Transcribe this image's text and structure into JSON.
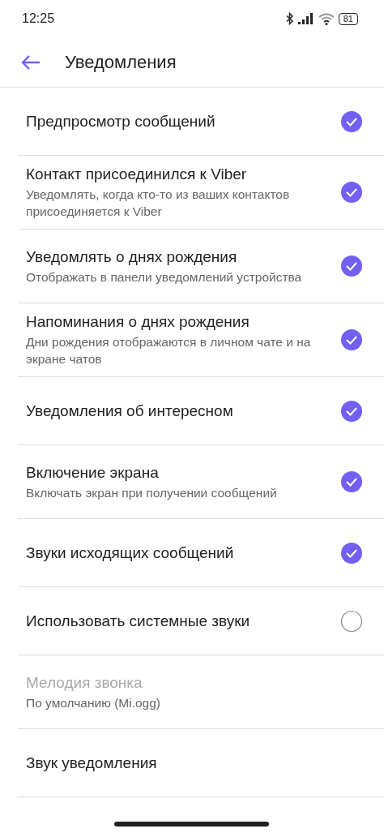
{
  "status_bar": {
    "time": "12:25",
    "battery": "81"
  },
  "header": {
    "title": "Уведомления"
  },
  "settings": [
    {
      "kind": "checkbox",
      "title": "Предпросмотр сообщений",
      "checked": true,
      "disabled": false
    },
    {
      "kind": "checkbox",
      "title": "Контакт присоединился к Viber",
      "subtitle": "Уведомлять, когда кто-то из ваших контактов присоединяется к Viber",
      "checked": true,
      "disabled": false
    },
    {
      "kind": "checkbox",
      "title": "Уведомлять о днях рождения",
      "subtitle": "Отображать в панели уведомлений устройства",
      "checked": true,
      "disabled": false
    },
    {
      "kind": "checkbox",
      "title": "Напоминания о днях рождения",
      "subtitle": "Дни рождения отображаются в личном чате и на экране чатов",
      "checked": true,
      "disabled": false
    },
    {
      "kind": "checkbox",
      "title": "Уведомления об интересном",
      "checked": true,
      "disabled": false
    },
    {
      "kind": "checkbox",
      "title": "Включение экрана",
      "subtitle": "Включать экран при получении сообщений",
      "checked": true,
      "disabled": false
    },
    {
      "kind": "checkbox",
      "title": "Звуки исходящих сообщений",
      "checked": true,
      "disabled": false
    },
    {
      "kind": "checkbox",
      "title": "Использовать системные звуки",
      "checked": false,
      "disabled": false
    },
    {
      "kind": "link",
      "title": "Мелодия звонка",
      "subtitle": "По умолчанию (Mi.ogg)",
      "disabled": true
    },
    {
      "kind": "link",
      "title": "Звук уведомления",
      "disabled": false
    }
  ]
}
